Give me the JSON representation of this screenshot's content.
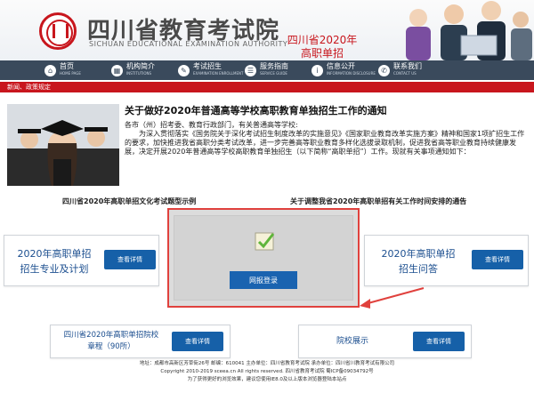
{
  "header": {
    "site_title": "四川省教育考试院",
    "site_subtitle": "SICHUAN EDUCATIONAL EXAMINATION AUTHORITY",
    "banner_line1": "四川省2020年",
    "banner_line2": "高职单招"
  },
  "nav": {
    "items": [
      {
        "label": "首页",
        "en": "HOME PAGE",
        "icon": "home-icon"
      },
      {
        "label": "机构简介",
        "en": "INSTITUTIONS",
        "icon": "building-icon"
      },
      {
        "label": "考试招生",
        "en": "EXAMINATION ENROLLMENT",
        "icon": "exam-icon"
      },
      {
        "label": "服务指南",
        "en": "SERVICE GUIDE",
        "icon": "service-icon"
      },
      {
        "label": "信息公开",
        "en": "INFORMATION DISCLOSURE",
        "icon": "info-icon"
      },
      {
        "label": "联系我们",
        "en": "CONTACT US",
        "icon": "contact-icon"
      }
    ]
  },
  "breadcrumb": "新闻、政策规定",
  "notice": {
    "title": "关于做好2020年普通高等学校高职教育单独招生工作的通知",
    "greeting": "各市（州）招考委、教育行政部门，有关普通高等学校:",
    "body": "为深入贯彻落实《国务院关于深化考试招生制度改革的实施意见》《国家职业教育改革实施方案》精神和国家1项扩招生工作的要求，加快推进我省高职分类考试改革，进一步完善高等职业教育多样化选拔录取机制，促进我省高等职业教育持续健康发展，决定开展2020年普通高等学校高职教育单独招生（以下简称“高职单招”）工作。现就有关事项通知如下："
  },
  "links": {
    "left": "四川省2020年高职单招文化考试题型示例",
    "right": "关于调整我省2020年高职单招有关工作时间安排的通告"
  },
  "cards": {
    "plan": {
      "line1": "2020年高职单招",
      "line2": "招生专业及计划",
      "button": "查看详情"
    },
    "faq": {
      "line1": "2020年高职单招",
      "line2": "招生问答",
      "button": "查看详情"
    },
    "charter": {
      "line1": "四川省2020年高职单招院校",
      "line2": "章程（90所）",
      "button": "查看详情"
    },
    "showcase": {
      "line1": "院校展示",
      "button": "查看详情"
    }
  },
  "login": {
    "button": "网报登录"
  },
  "footer": {
    "line1": "地址：成都市高新区芳草街26号  邮编：610041  主办单位：四川省教育考试院  承办单位：四川省川教育考试有限公司",
    "line2": "Copyright 2010-2019 sceea.cn All rights reserved. 四川省教育考试院 蜀ICP备09034792号",
    "line3": "为了获得更好的浏览效果，建议您使用IE8.0及以上版本浏览器登陆本站点"
  },
  "colors": {
    "brand_red": "#c8161d",
    "nav_bg": "#3a4a5c",
    "button_blue": "#1660a8"
  }
}
